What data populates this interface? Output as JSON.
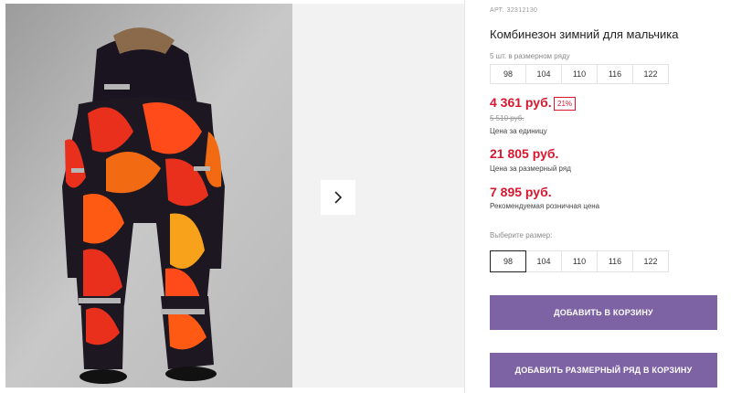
{
  "product": {
    "article_label": "АРТ.",
    "article": "32312130",
    "title": "Комбинезон зимний для мальчика",
    "range_label": "5 шт. в размерном ряду",
    "range_sizes": [
      "98",
      "104",
      "110",
      "116",
      "122"
    ],
    "price": "4 361 руб.",
    "discount": "21%",
    "old_price": "5 510 руб.",
    "price_note": "Цена за единицу",
    "range_price": "21 805 руб.",
    "range_price_note": "Цена за размерный ряд",
    "retail_price": "7 895 руб.",
    "retail_price_note": "Рекомендуемая розничная цена"
  },
  "size_picker": {
    "label": "Выберите размер:",
    "sizes": [
      "98",
      "104",
      "110",
      "116",
      "122"
    ],
    "selected": "98"
  },
  "actions": {
    "add_to_cart": "ДОБАВИТЬ В КОРЗИНУ",
    "add_range_to_cart": "ДОБАВИТЬ РАЗМЕРНЫЙ РЯД В КОРЗИНУ"
  },
  "gallery": {
    "next_icon": "chevron-right-icon"
  },
  "colors": {
    "accent": "#7d63a3",
    "price": "#d7172f"
  }
}
